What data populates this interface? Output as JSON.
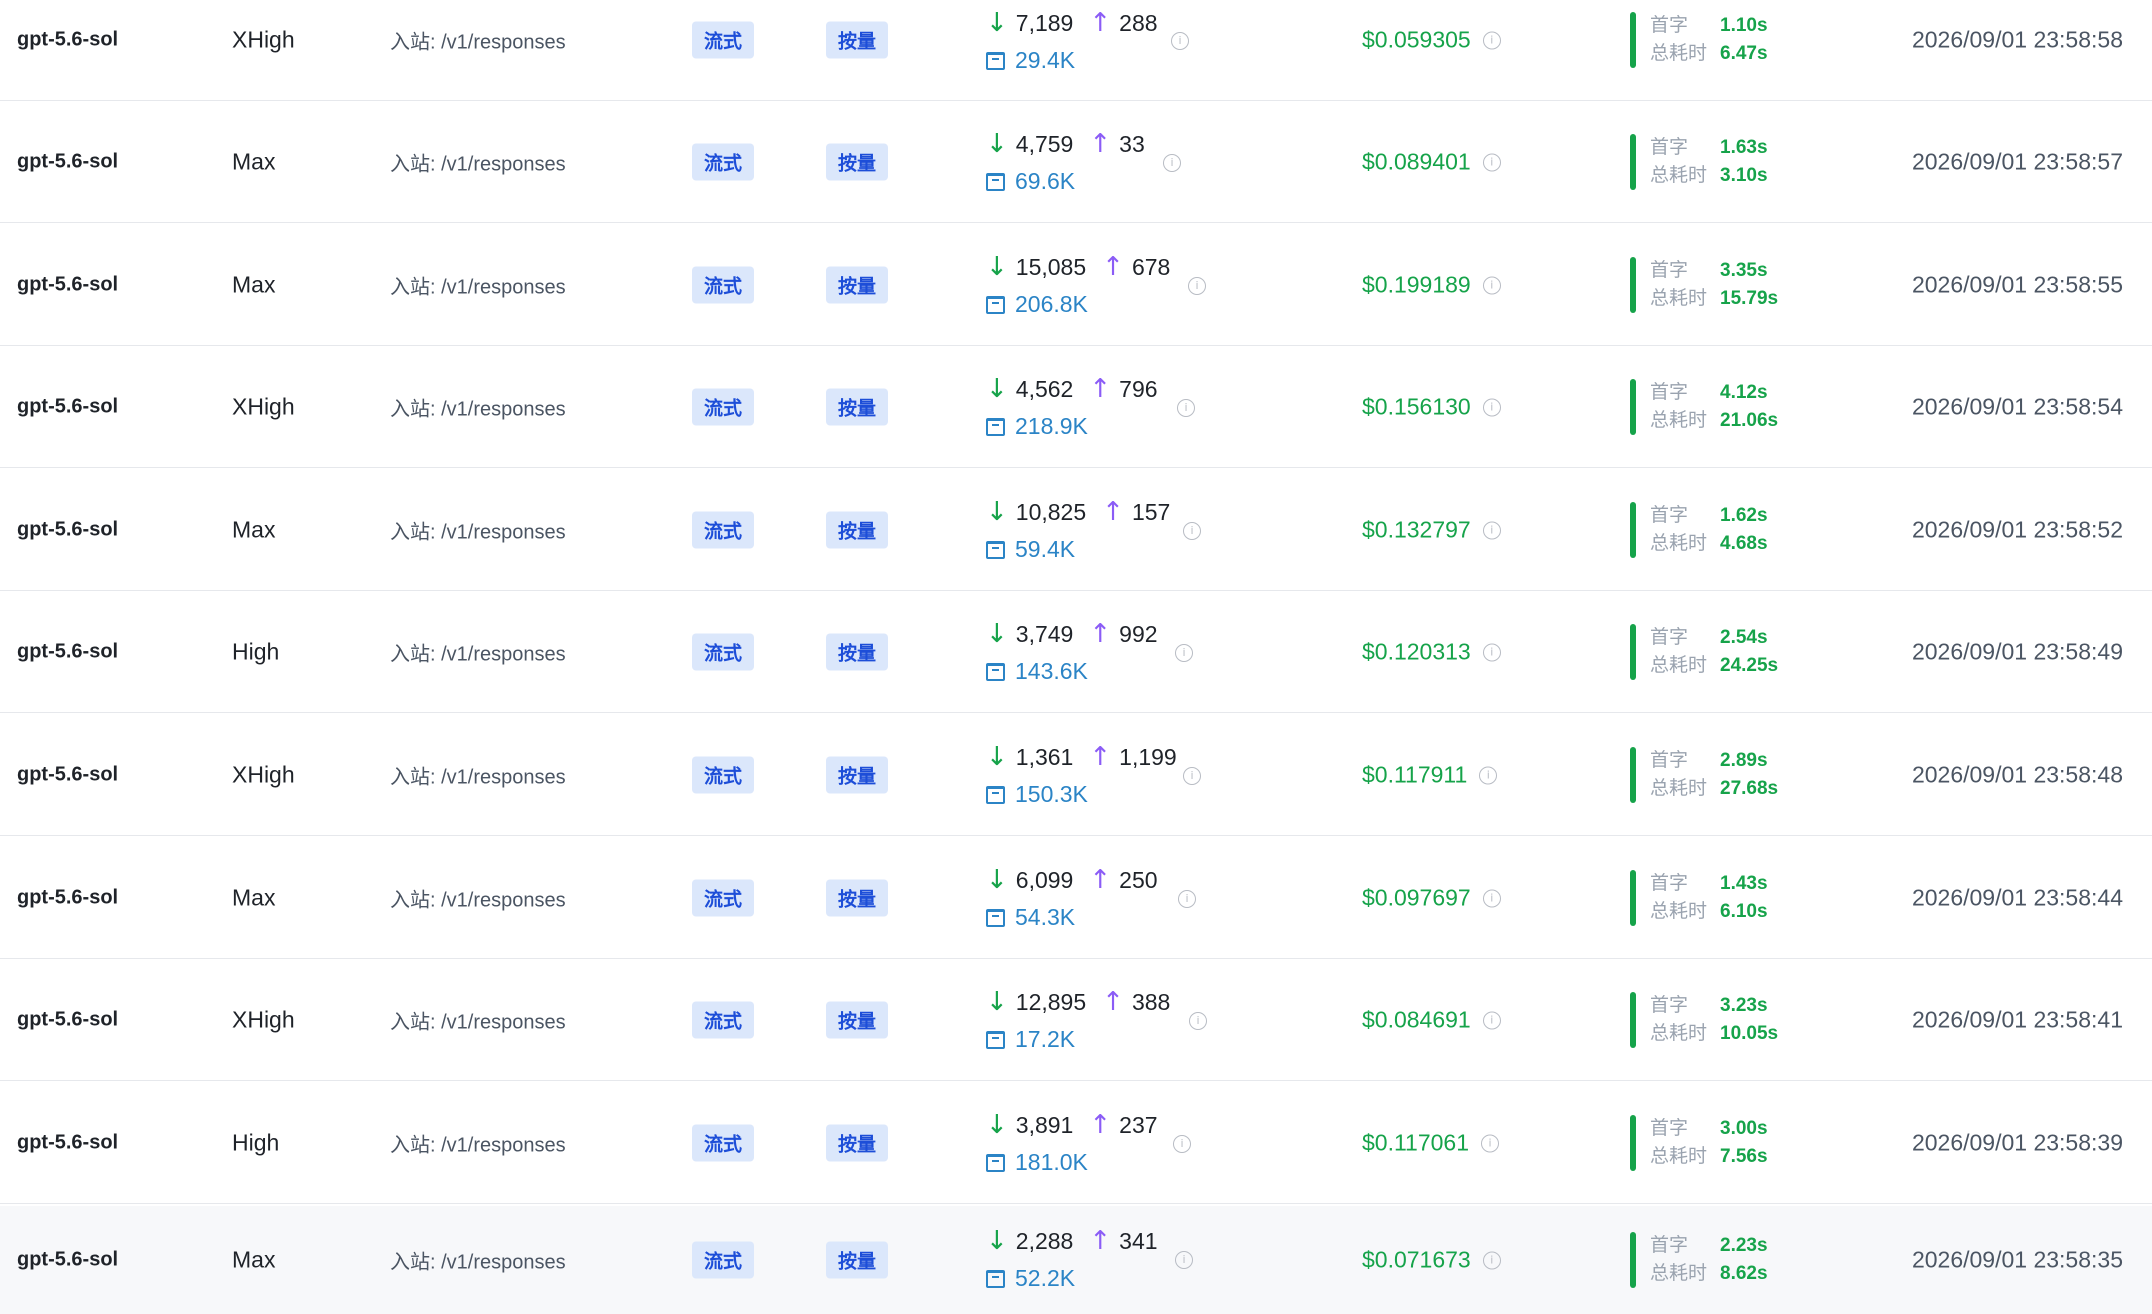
{
  "labels": {
    "endpoint_prefix": "入站: ",
    "stream_tag": "流式",
    "billing_tag": "按量",
    "first_token_label": "首字",
    "total_time_label": "总耗时"
  },
  "icons": {
    "input_tokens": "arrow-down-icon",
    "output_tokens": "arrow-up-icon",
    "cache": "cache-icon",
    "info": "info-icon"
  },
  "colors": {
    "cost": "#16a34a",
    "input_arrow": "#16a34a",
    "output_arrow": "#8b5cf6",
    "cache": "#2b84c6",
    "tag_bg": "#dbe7fb",
    "tag_text": "#1d4ed8"
  },
  "rows": [
    {
      "model": "gpt-5.6-sol",
      "effort": "XHigh",
      "endpoint": "入站: /v1/responses",
      "stream": "流式",
      "billing": "按量",
      "input": "7,189",
      "output": "288",
      "cache": "29.4K",
      "cost": "$0.059305",
      "first": "首字",
      "first_val": "1.10s",
      "total": "总耗时",
      "total_val": "6.47s",
      "time": "2026/09/01 23:58:58"
    },
    {
      "model": "gpt-5.6-sol",
      "effort": "Max",
      "endpoint": "入站: /v1/responses",
      "stream": "流式",
      "billing": "按量",
      "input": "4,759",
      "output": "33",
      "cache": "69.6K",
      "cost": "$0.089401",
      "first": "首字",
      "first_val": "1.63s",
      "total": "总耗时",
      "total_val": "3.10s",
      "time": "2026/09/01 23:58:57"
    },
    {
      "model": "gpt-5.6-sol",
      "effort": "Max",
      "endpoint": "入站: /v1/responses",
      "stream": "流式",
      "billing": "按量",
      "input": "15,085",
      "output": "678",
      "cache": "206.8K",
      "cost": "$0.199189",
      "first": "首字",
      "first_val": "3.35s",
      "total": "总耗时",
      "total_val": "15.79s",
      "time": "2026/09/01 23:58:55"
    },
    {
      "model": "gpt-5.6-sol",
      "effort": "XHigh",
      "endpoint": "入站: /v1/responses",
      "stream": "流式",
      "billing": "按量",
      "input": "4,562",
      "output": "796",
      "cache": "218.9K",
      "cost": "$0.156130",
      "first": "首字",
      "first_val": "4.12s",
      "total": "总耗时",
      "total_val": "21.06s",
      "time": "2026/09/01 23:58:54"
    },
    {
      "model": "gpt-5.6-sol",
      "effort": "Max",
      "endpoint": "入站: /v1/responses",
      "stream": "流式",
      "billing": "按量",
      "input": "10,825",
      "output": "157",
      "cache": "59.4K",
      "cost": "$0.132797",
      "first": "首字",
      "first_val": "1.62s",
      "total": "总耗时",
      "total_val": "4.68s",
      "time": "2026/09/01 23:58:52"
    },
    {
      "model": "gpt-5.6-sol",
      "effort": "High",
      "endpoint": "入站: /v1/responses",
      "stream": "流式",
      "billing": "按量",
      "input": "3,749",
      "output": "992",
      "cache": "143.6K",
      "cost": "$0.120313",
      "first": "首字",
      "first_val": "2.54s",
      "total": "总耗时",
      "total_val": "24.25s",
      "time": "2026/09/01 23:58:49"
    },
    {
      "model": "gpt-5.6-sol",
      "effort": "XHigh",
      "endpoint": "入站: /v1/responses",
      "stream": "流式",
      "billing": "按量",
      "input": "1,361",
      "output": "1,199",
      "cache": "150.3K",
      "cost": "$0.117911",
      "first": "首字",
      "first_val": "2.89s",
      "total": "总耗时",
      "total_val": "27.68s",
      "time": "2026/09/01 23:58:48"
    },
    {
      "model": "gpt-5.6-sol",
      "effort": "Max",
      "endpoint": "入站: /v1/responses",
      "stream": "流式",
      "billing": "按量",
      "input": "6,099",
      "output": "250",
      "cache": "54.3K",
      "cost": "$0.097697",
      "first": "首字",
      "first_val": "1.43s",
      "total": "总耗时",
      "total_val": "6.10s",
      "time": "2026/09/01 23:58:44"
    },
    {
      "model": "gpt-5.6-sol",
      "effort": "XHigh",
      "endpoint": "入站: /v1/responses",
      "stream": "流式",
      "billing": "按量",
      "input": "12,895",
      "output": "388",
      "cache": "17.2K",
      "cost": "$0.084691",
      "first": "首字",
      "first_val": "3.23s",
      "total": "总耗时",
      "total_val": "10.05s",
      "time": "2026/09/01 23:58:41"
    },
    {
      "model": "gpt-5.6-sol",
      "effort": "High",
      "endpoint": "入站: /v1/responses",
      "stream": "流式",
      "billing": "按量",
      "input": "3,891",
      "output": "237",
      "cache": "181.0K",
      "cost": "$0.117061",
      "first": "首字",
      "first_val": "3.00s",
      "total": "总耗时",
      "total_val": "7.56s",
      "time": "2026/09/01 23:58:39"
    },
    {
      "model": "gpt-5.6-sol",
      "effort": "Max",
      "endpoint": "入站: /v1/responses",
      "stream": "流式",
      "billing": "按量",
      "input": "2,288",
      "output": "341",
      "cache": "52.2K",
      "cost": "$0.071673",
      "first": "首字",
      "first_val": "2.23s",
      "total": "总耗时",
      "total_val": "8.62s",
      "time": "2026/09/01 23:58:35"
    }
  ]
}
